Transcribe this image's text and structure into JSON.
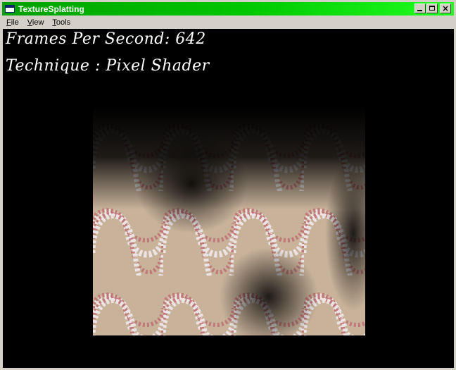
{
  "window": {
    "title": "TextureSplatting",
    "controls": {
      "minimize": "minimize",
      "maximize": "maximize",
      "close": "×"
    }
  },
  "menu": {
    "items": [
      {
        "accel": "F",
        "rest": "ile"
      },
      {
        "accel": "V",
        "rest": "iew"
      },
      {
        "accel": "T",
        "rest": "ools"
      }
    ]
  },
  "overlay": {
    "fps_label": "Frames Per Second: 642",
    "technique_label": "Technique : Pixel Shader"
  },
  "colors": {
    "titlebar_start": "#00a000",
    "titlebar_end": "#20ff20",
    "viewport_bg": "#000000",
    "tile_base": "#c8b29a",
    "tile_pink": "#c07878",
    "tile_white": "#ece4e4"
  }
}
